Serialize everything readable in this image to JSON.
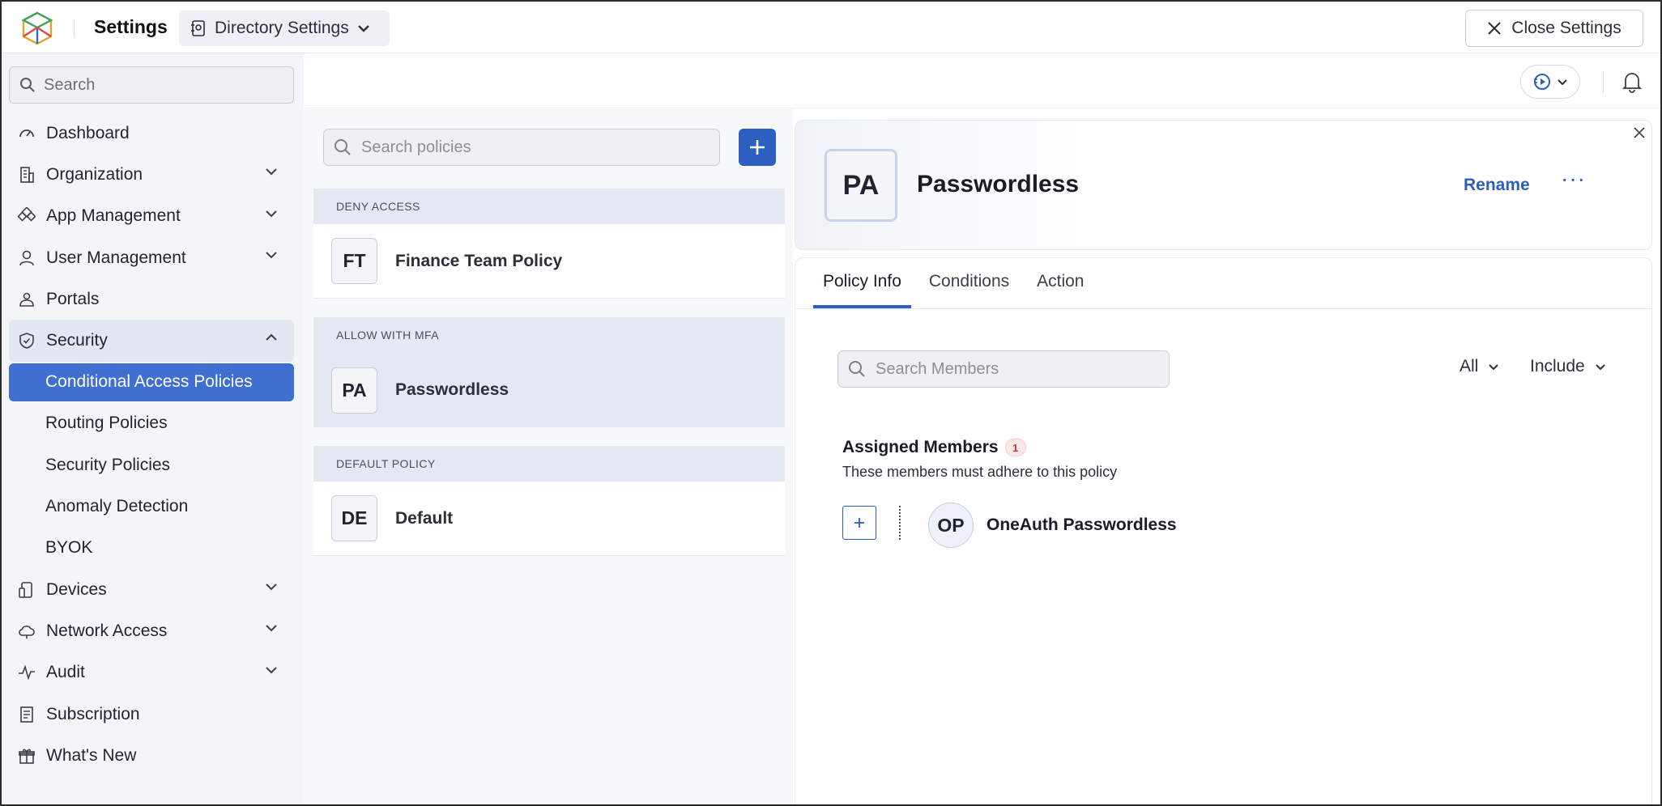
{
  "topbar": {
    "title": "Settings",
    "directory_label": "Directory Settings",
    "close_label": "Close Settings"
  },
  "sidebar": {
    "search_placeholder": "Search",
    "items": [
      {
        "label": "Dashboard",
        "icon": "gauge-icon"
      },
      {
        "label": "Organization",
        "icon": "building-icon",
        "expandable": true
      },
      {
        "label": "App Management",
        "icon": "apps-icon",
        "expandable": true
      },
      {
        "label": "User Management",
        "icon": "user-icon",
        "expandable": true
      },
      {
        "label": "Portals",
        "icon": "portal-icon"
      },
      {
        "label": "Security",
        "icon": "shield-icon",
        "expandable": true,
        "expanded": true
      }
    ],
    "security_sub": [
      {
        "label": "Conditional Access Policies",
        "active": true
      },
      {
        "label": "Routing Policies"
      },
      {
        "label": "Security Policies"
      },
      {
        "label": "Anomaly Detection"
      },
      {
        "label": "BYOK"
      }
    ],
    "items_after": [
      {
        "label": "Devices",
        "icon": "device-icon",
        "expandable": true
      },
      {
        "label": "Network Access",
        "icon": "cloud-icon",
        "expandable": true
      },
      {
        "label": "Audit",
        "icon": "pulse-icon",
        "expandable": true
      },
      {
        "label": "Subscription",
        "icon": "receipt-icon"
      },
      {
        "label": "What's New",
        "icon": "gift-icon"
      }
    ]
  },
  "policies": {
    "search_placeholder": "Search policies",
    "groups": [
      {
        "heading": "DENY ACCESS",
        "items": [
          {
            "initials": "FT",
            "name": "Finance Team Policy"
          }
        ]
      },
      {
        "heading": "ALLOW WITH MFA",
        "items": [
          {
            "initials": "PA",
            "name": "Passwordless",
            "selected": true
          }
        ]
      },
      {
        "heading": "DEFAULT POLICY",
        "items": [
          {
            "initials": "DE",
            "name": "Default"
          }
        ]
      }
    ]
  },
  "detail": {
    "initials": "PA",
    "title": "Passwordless",
    "rename_label": "Rename",
    "more_label": "···",
    "tabs": [
      "Policy Info",
      "Conditions",
      "Action"
    ],
    "active_tab": "Policy Info",
    "member_search_placeholder": "Search Members",
    "filter_scope": "All",
    "filter_mode": "Include",
    "assigned_title": "Assigned Members",
    "assigned_count": "1",
    "assigned_subtitle": "These members must adhere to this policy",
    "members": [
      {
        "initials": "OP",
        "name": "OneAuth Passwordless"
      }
    ]
  },
  "colors": {
    "accent": "#2c5fbf",
    "active_nav": "#3e6fd1",
    "sidebar_bg": "#f4f5f8"
  }
}
